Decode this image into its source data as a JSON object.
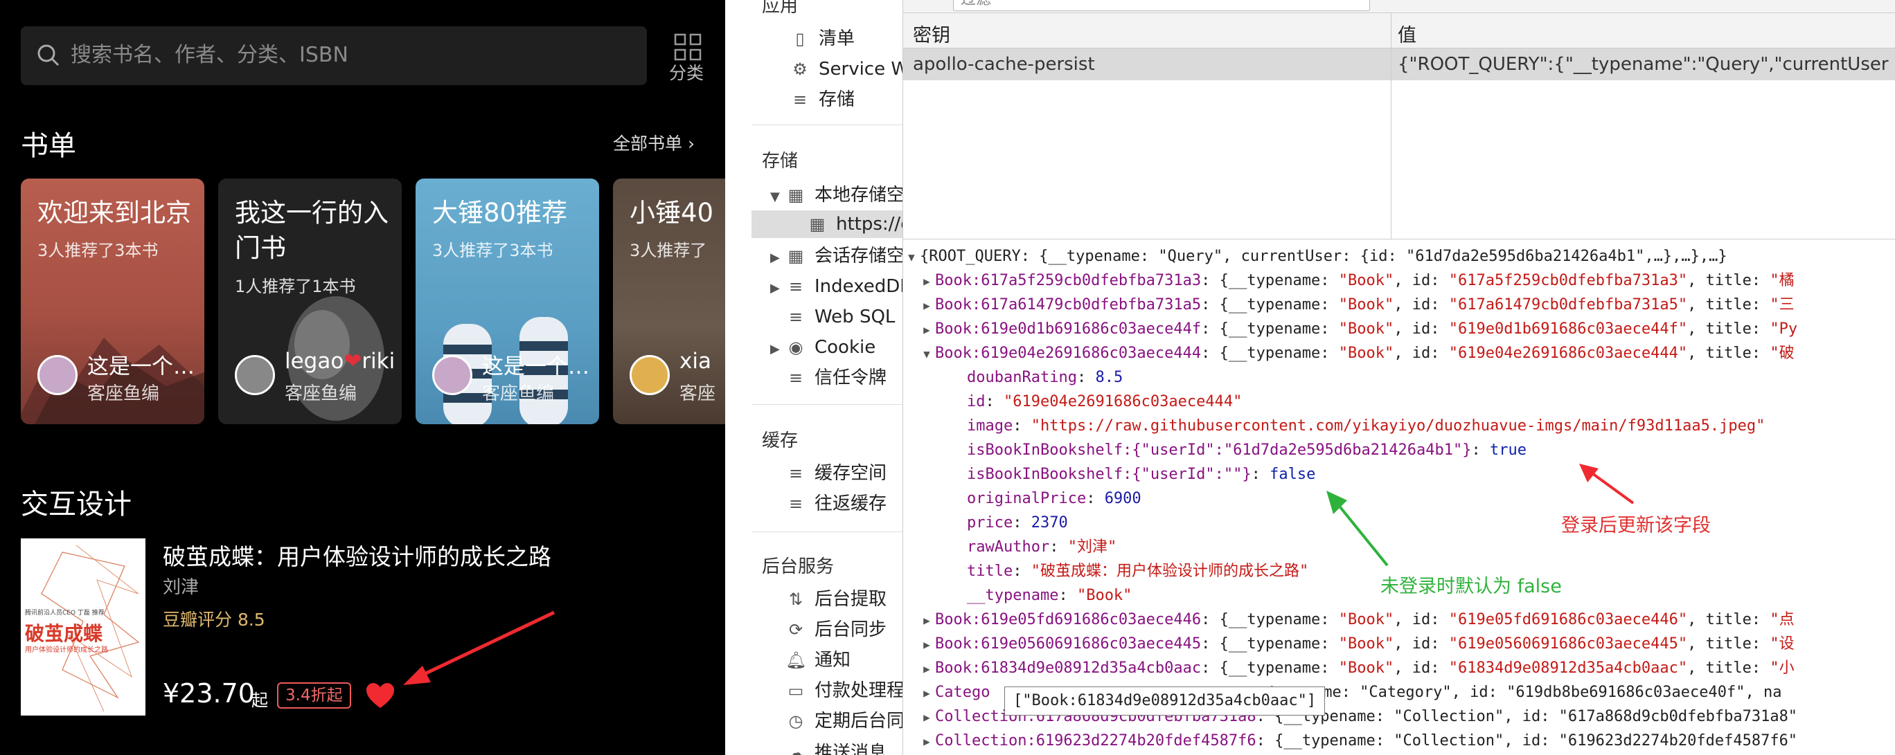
{
  "app": {
    "search_placeholder": "搜索书名、作者、分类、ISBN",
    "category_label": "分类",
    "booklist": {
      "title": "书单",
      "more_label": "全部书单",
      "cards": [
        {
          "title": "欢迎来到北京",
          "subtitle": "3人推荐了3本书",
          "author": "这是一个…",
          "role": "客座鱼编",
          "color": "#b0594c"
        },
        {
          "title": "我这一行的入门书",
          "subtitle": "1人推荐了1本书",
          "author": "legao",
          "author2": "riki",
          "role": "客座鱼编",
          "color": "#3a3a3a"
        },
        {
          "title": "大锤80推荐",
          "subtitle": "3人推荐了3本书",
          "author": "这是一个…",
          "role": "客座鱼编",
          "color": "#5b9ec3"
        },
        {
          "title": "小锤40",
          "subtitle": "3人推荐了",
          "author": "xia",
          "role": "客座",
          "color": "#6a5a4d"
        }
      ]
    },
    "section2": {
      "title": "交互设计",
      "book": {
        "title": "破茧成蝶：用户体验设计师的成长之路",
        "author": "刘津",
        "rating": "豆瓣评分 8.5",
        "price": "¥23.70",
        "price_suffix": "起",
        "discount": "3.4折起",
        "cover_title": "破茧成蝶",
        "cover_tagline": "用户体验设计师的成长之路",
        "cover_top": "腾讯前沿人员CEO 丁磊 推荐"
      }
    }
  },
  "devtools": {
    "sidebar": {
      "app_header": "应用",
      "app_items": [
        "清单",
        "Service Wo",
        "存储"
      ],
      "storage_header": "存储",
      "storage_items": [
        {
          "label": "本地存储空",
          "expanded": true
        },
        {
          "label": "https://d",
          "selected": true
        },
        {
          "label": "会话存储空"
        },
        {
          "label": "IndexedDB"
        },
        {
          "label": "Web SQL"
        },
        {
          "label": "Cookie"
        },
        {
          "label": "信任令牌"
        }
      ],
      "cache_header": "缓存",
      "cache_items": [
        "缓存空间",
        "往返缓存"
      ],
      "bg_header": "后台服务",
      "bg_items": [
        "后台提取",
        "后台同步",
        "通知",
        "付款处理程",
        "定期后台同",
        "推送消息"
      ]
    },
    "filter_placeholder": "过滤",
    "table": {
      "col_key": "密钥",
      "col_value": "值",
      "row_key": "apollo-cache-persist",
      "row_value": "{\"ROOT_QUERY\":{\"__typename\":\"Query\",\"currentUser\":{\"i..."
    },
    "tree": {
      "root": "{ROOT_QUERY: {__typename: \"Query\", currentUser: {id: \"61d7da2e595d6ba21426a4b1\",…},…},…}",
      "books_before": [
        {
          "key": "Book:617a5f259cb0dfebfba731a3",
          "id": "617a5f259cb0dfebfba731a3",
          "title_start": "橘"
        },
        {
          "key": "Book:617a61479cb0dfebfba731a5",
          "id": "617a61479cb0dfebfba731a5",
          "title_start": "三"
        },
        {
          "key": "Book:619e0d1b691686c03aece44f",
          "id": "619e0d1b691686c03aece44f",
          "title_start": "Py"
        }
      ],
      "expanded": {
        "key": "Book:619e04e2691686c03aece444",
        "id": "619e04e2691686c03aece444",
        "title_start": "破",
        "doubanRating": "8.5",
        "image": "\"https://raw.githubusercontent.com/yikayiyo/duozhuavue-imgs/main/f93d11aa5.jpeg\"",
        "shelf1_key": "isBookInBookshelf:{\"userId\":\"61d7da2e595d6ba21426a4b1\"}",
        "shelf1_val": "true",
        "shelf2_key": "isBookInBookshelf:{\"userId\":\"\"}",
        "shelf2_val": "false",
        "originalPrice": "6900",
        "price": "2370",
        "rawAuthor": "\"刘津\"",
        "title": "\"破茧成蝶：用户体验设计师的成长之路\"",
        "typename": "\"Book\""
      },
      "books_after": [
        {
          "key": "Book:619e05fd691686c03aece446",
          "id": "619e05fd691686c03aece446",
          "title_start": "点"
        },
        {
          "key": "Book:619e0560691686c03aece445",
          "id": "619e0560691686c03aece445",
          "title_start": "设"
        },
        {
          "key": "Book:61834d9e08912d35a4cb0aac",
          "id": "61834d9e08912d35a4cb0aac",
          "title_start": "小"
        }
      ],
      "category": {
        "key_start": "Catego",
        "rest": "_typename: \"Category\", id: \"619db8be691686c03aece40f\", na"
      },
      "collections": [
        {
          "key": "Collection:617a868d9cb0dfebfba731a8",
          "rest": ": {__typename: \"Collection\", id: \"617a868d9cb0dfebfba731a8\""
        },
        {
          "key": "Collection:619623d2274b20fdef4587f6",
          "rest": ": {__typename: \"Collection\", id: \"619623d2274b20fdef4587f6\""
        }
      ],
      "tooltip": "[\"Book:61834d9e08912d35a4cb0aac\"]"
    },
    "annotations": {
      "login_update": "登录后更新该字段",
      "default_false": "未登录时默认为 false"
    }
  }
}
